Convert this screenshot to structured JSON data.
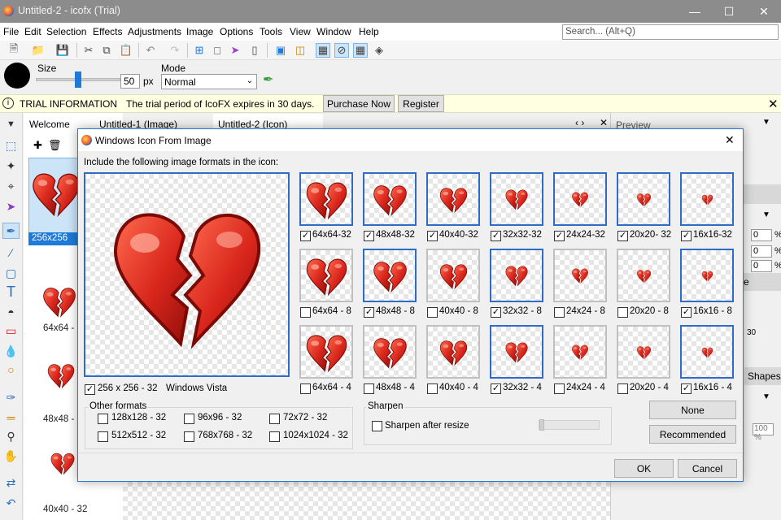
{
  "window": {
    "title": "Untitled-2 - icofx (Trial)"
  },
  "menu": [
    "File",
    "Edit",
    "Selection",
    "Effects",
    "Adjustments",
    "Image",
    "Options",
    "Tools",
    "View",
    "Window",
    "Help"
  ],
  "search": {
    "placeholder": "Search... (Alt+Q)"
  },
  "options": {
    "size_label": "Size",
    "size_value": "50",
    "size_unit": "px",
    "size_fraction": 0.5,
    "mode_label": "Mode",
    "mode_value": "Normal",
    "brush_color": "#000000"
  },
  "trial": {
    "title": "TRIAL INFORMATION",
    "message": "The trial period of IcoFX expires in 30 days.",
    "purchase_label": "Purchase Now",
    "register_label": "Register"
  },
  "doc_tabs": [
    "Welcome",
    "Untitled-1 (Image)",
    "Untitled-2 (Icon)"
  ],
  "thumbnails": [
    "256x256",
    "64x64 -",
    "48x48 -",
    "40x40 - 32"
  ],
  "right_panel": {
    "preview_label": "Preview",
    "fields": [
      "0",
      "0",
      "0"
    ],
    "percent_sign": "%",
    "e_label": "e",
    "brush_size": "30",
    "shapes_label": "Shapes",
    "opacity": "100 %"
  },
  "dialog": {
    "title": "Windows Icon From Image",
    "instruction": "Include the following image formats in the icon:",
    "main_check_label": "256 x 256 - 32",
    "main_check_os": "Windows Vista",
    "main_checked": true,
    "grid_rows": [
      [
        {
          "label": "64x64-32",
          "checked": true
        },
        {
          "label": "48x48-32",
          "checked": true
        },
        {
          "label": "40x40-32",
          "checked": true
        },
        {
          "label": "32x32-32",
          "checked": true
        },
        {
          "label": "24x24-32",
          "checked": true
        },
        {
          "label": "20x20- 32",
          "checked": true
        },
        {
          "label": "16x16-32",
          "checked": true
        }
      ],
      [
        {
          "label": "64x64 - 8",
          "checked": false
        },
        {
          "label": "48x48 - 8",
          "checked": true
        },
        {
          "label": "40x40 - 8",
          "checked": false
        },
        {
          "label": "32x32 - 8",
          "checked": true
        },
        {
          "label": "24x24 - 8",
          "checked": false
        },
        {
          "label": "20x20 - 8",
          "checked": false
        },
        {
          "label": "16x16 - 8",
          "checked": true
        }
      ],
      [
        {
          "label": "64x64 - 4",
          "checked": false
        },
        {
          "label": "48x48 - 4",
          "checked": false
        },
        {
          "label": "40x40 - 4",
          "checked": false
        },
        {
          "label": "32x32 - 4",
          "checked": true
        },
        {
          "label": "24x24 - 4",
          "checked": false
        },
        {
          "label": "20x20 - 4",
          "checked": false
        },
        {
          "label": "16x16 - 4",
          "checked": true
        }
      ]
    ],
    "other_formats_title": "Other formats",
    "other_formats": [
      {
        "label": "128x128 - 32",
        "checked": false
      },
      {
        "label": "96x96 - 32",
        "checked": false
      },
      {
        "label": "72x72 - 32",
        "checked": false
      },
      {
        "label": "512x512 - 32",
        "checked": false
      },
      {
        "label": "768x768 - 32",
        "checked": false
      },
      {
        "label": "1024x1024 - 32",
        "checked": false
      }
    ],
    "sharpen_title": "Sharpen",
    "sharpen_label": "Sharpen after resize",
    "sharpen_checked": false,
    "none_label": "None",
    "recommended_label": "Recommended",
    "ok_label": "OK",
    "cancel_label": "Cancel"
  },
  "colors": {
    "accent": "#2f6cc5",
    "heart": "#d9261c",
    "trial_bg": "#ffffe1",
    "titlebar": "#8c8c8c"
  }
}
